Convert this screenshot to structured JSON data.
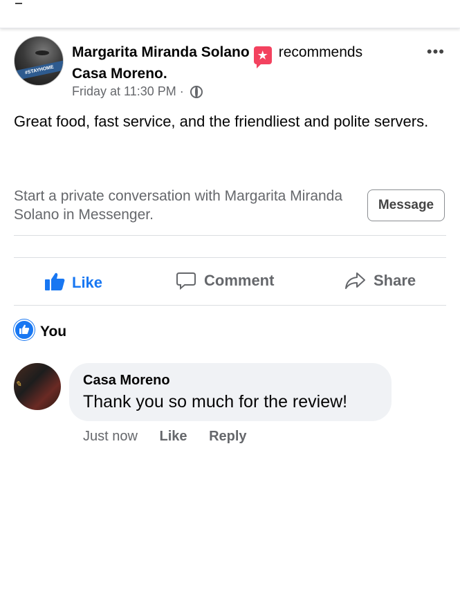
{
  "post": {
    "author": "Margarita Miranda Solano",
    "action": "recommends",
    "place": "Casa Moreno.",
    "timestamp": "Friday at 11:30 PM",
    "separator": "·",
    "privacy_icon": "globe-icon",
    "more_label": "•••",
    "avatar_caption": "#STAYHOME",
    "text": "Great food, fast service, and the friendliest and polite servers."
  },
  "messenger": {
    "prompt": "Start a private conversation with Margarita Miranda Solano in Messenger.",
    "button_label": "Message"
  },
  "actions": {
    "like": "Like",
    "comment": "Comment",
    "share": "Share"
  },
  "reactions": {
    "label": "You"
  },
  "comment": {
    "author": "Casa Moreno",
    "text": "Thank you so much for the review!",
    "time": "Just now",
    "like": "Like",
    "reply": "Reply"
  },
  "colors": {
    "accent": "#1877f2",
    "recommend_badge": "#f3425f",
    "secondary_text": "#65676b",
    "bubble_bg": "#f0f2f5"
  }
}
